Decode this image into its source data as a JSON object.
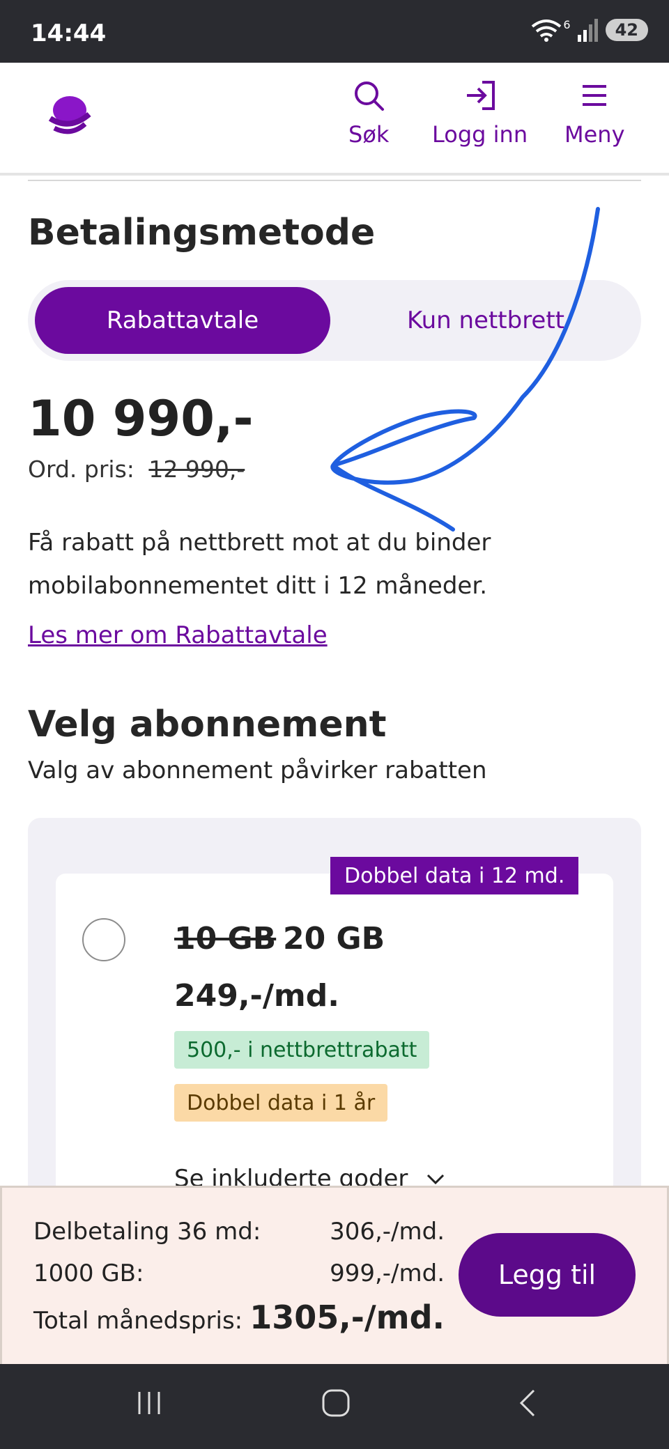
{
  "status_bar": {
    "time": "14:44",
    "battery": "42",
    "signal_label": "6"
  },
  "header": {
    "nav": {
      "search": "Søk",
      "login": "Logg inn",
      "menu": "Meny"
    },
    "brand_color": "#6b0a9e"
  },
  "payment": {
    "heading": "Betalingsmetode",
    "options": [
      "Rabattavtale",
      "Kun nettbrett"
    ],
    "selected": "Rabattavtale",
    "price": "10 990,-",
    "ord_label": "Ord. pris:",
    "ord_value": "12 990,-",
    "description": "Få rabatt på nettbrett mot at du binder mobilabonnementet ditt i 12 måneder.",
    "read_more": "Les mer om Rabattavtale"
  },
  "subscription": {
    "heading": "Velg abonnement",
    "subheading": "Valg av abonnement påvirker rabatten",
    "plan": {
      "tag": "Dobbel data i 12 md.",
      "data_old": "10 GB",
      "data_new": "20 GB",
      "price": "249,-/md.",
      "badge_discount": "500,- i nettbrettrabatt",
      "badge_data": "Dobbel data i 1 år",
      "see_included": "Se inkluderte goder"
    }
  },
  "summary": {
    "row1_label": "Delbetaling 36 md:",
    "row1_value": "306,-/md.",
    "row2_label": "1000 GB:",
    "row2_value": "999,-/md.",
    "total_label": "Total månedspris:",
    "total_value": "1305,-/md.",
    "cta": "Legg til"
  },
  "icons": {
    "search": "search-icon",
    "login": "login-icon",
    "menu": "menu-icon",
    "wifi": "wifi-icon",
    "signal": "signal-icon",
    "recents": "recents-icon",
    "home": "home-icon",
    "back": "back-icon",
    "chevron": "chevron-down-icon"
  },
  "annotation_color": "#1f5fe0"
}
